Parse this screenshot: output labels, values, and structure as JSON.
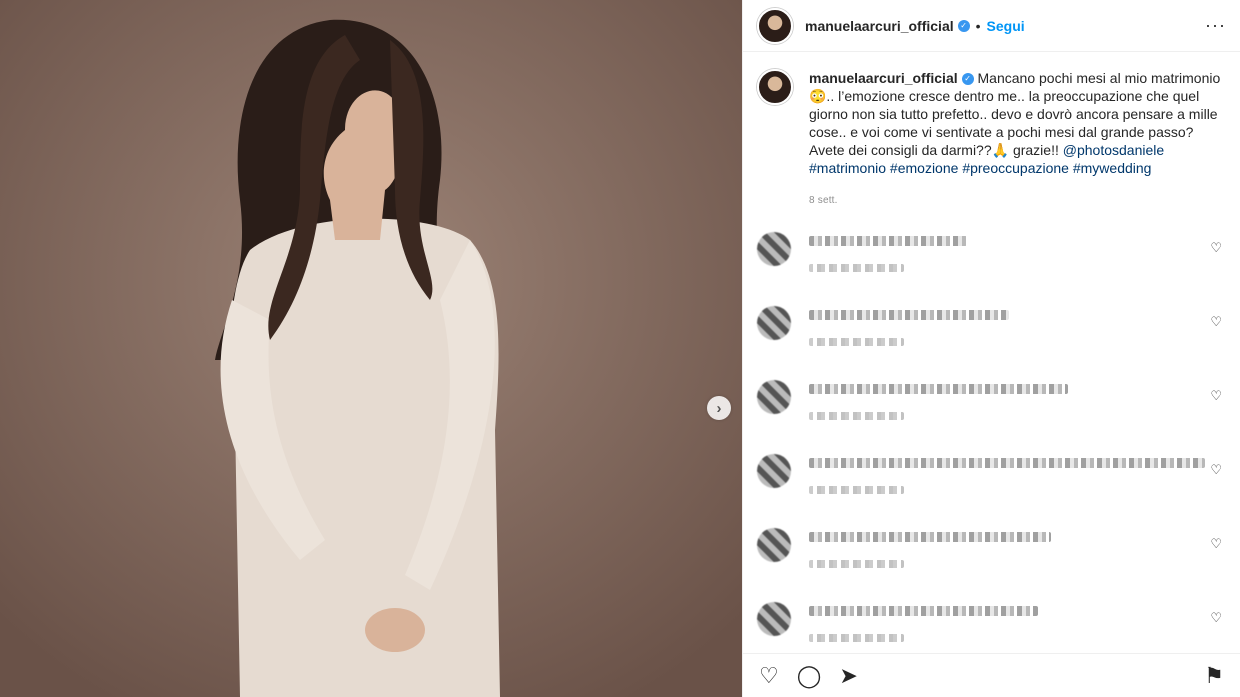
{
  "post": {
    "username": "manuelaarcuri_official",
    "follow_label": "Segui",
    "more_label": "···",
    "caption_parts": {
      "text": "Mancano pochi mesi al mio matrimonio 😳.. l’emozione cresce dentro me.. la preoccupazione che quel giorno non sia tutto prefetto.. devo e dovrò ancora pensare a mille cose.. e voi come vi sentivate a pochi mesi dal grande passo? Avete dei consigli da darmi??🙏 grazie!! ",
      "mention": "@photosdaniele",
      "tags": [
        "#matrimonio",
        "#emozione",
        "#preoccupazione",
        "#mywedding"
      ]
    },
    "time": "8 sett."
  },
  "media": {
    "next_glyph": "›"
  },
  "comments": [
    {
      "line_width": 0.38,
      "heart": "♡"
    },
    {
      "line_width": 0.48,
      "heart": "♡"
    },
    {
      "line_width": 0.62,
      "heart": "♡"
    },
    {
      "line_width": 0.95,
      "heart": "♡"
    },
    {
      "line_width": 0.58,
      "heart": "♡"
    },
    {
      "line_width": 0.55,
      "heart": "♡"
    }
  ],
  "actions": {
    "like": "♡",
    "comment": "◯",
    "share": "➤",
    "save": "⚑"
  }
}
